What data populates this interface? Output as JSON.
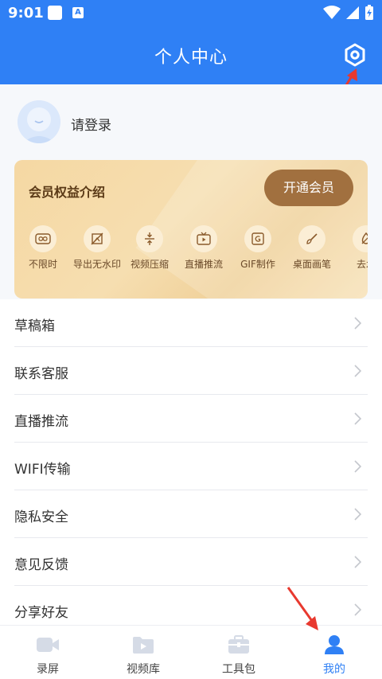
{
  "status_bar": {
    "time": "9:01",
    "a_badge": "A"
  },
  "header": {
    "title": "个人中心"
  },
  "profile": {
    "login_text": "请登录"
  },
  "vip": {
    "title": "会员权益介绍",
    "button": "开通会员",
    "features": [
      {
        "label": "不限时",
        "icon": "infinity-icon"
      },
      {
        "label": "导出无水印",
        "icon": "no-watermark-icon"
      },
      {
        "label": "视频压缩",
        "icon": "compress-icon"
      },
      {
        "label": "直播推流",
        "icon": "live-tv-icon"
      },
      {
        "label": "GIF制作",
        "icon": "gif-icon"
      },
      {
        "label": "桌面画笔",
        "icon": "brush-icon"
      },
      {
        "label": "去水",
        "icon": "remove-watermark-icon"
      }
    ]
  },
  "menu": {
    "items": [
      {
        "label": "草稿箱"
      },
      {
        "label": "联系客服"
      },
      {
        "label": "直播推流"
      },
      {
        "label": "WIFI传输"
      },
      {
        "label": "隐私安全"
      },
      {
        "label": "意见反馈"
      },
      {
        "label": "分享好友"
      }
    ]
  },
  "tabs": [
    {
      "label": "录屏",
      "icon": "video-camera-icon",
      "active": false
    },
    {
      "label": "视频库",
      "icon": "video-folder-icon",
      "active": false
    },
    {
      "label": "工具包",
      "icon": "toolbox-icon",
      "active": false
    },
    {
      "label": "我的",
      "icon": "user-icon",
      "active": true
    }
  ],
  "colors": {
    "primary": "#2f80f5",
    "vip_button": "#a1703f",
    "annotation_arrow": "#e8392f"
  }
}
